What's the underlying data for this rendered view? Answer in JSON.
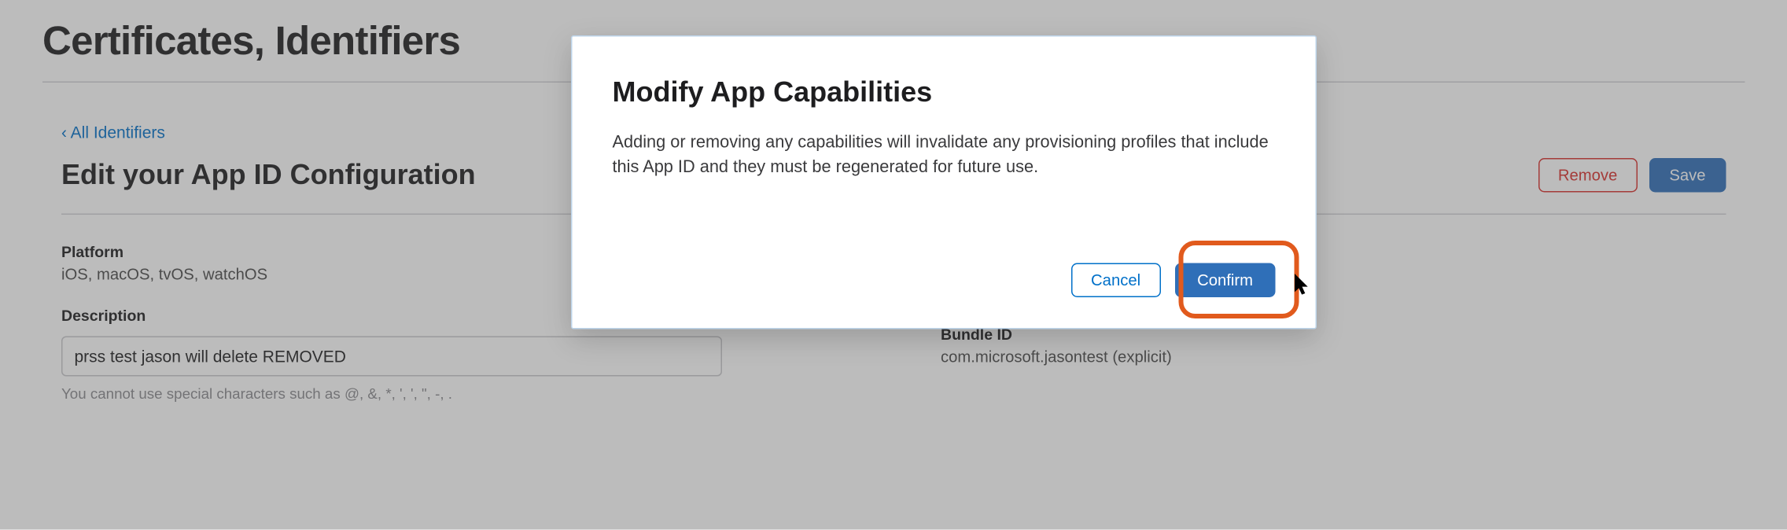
{
  "page": {
    "title": "Certificates, Identifiers",
    "back_link": "‹ All Identifiers",
    "section_title": "Edit your App ID Configuration"
  },
  "actions": {
    "remove": "Remove",
    "save": "Save"
  },
  "fields": {
    "platform_label": "Platform",
    "platform_value": "iOS, macOS, tvOS, watchOS",
    "description_label": "Description",
    "description_value": "prss test jason will delete REMOVED",
    "description_hint": "You cannot use special characters such as @, &, *, ', ', \", -, .",
    "bundle_label": "Bundle ID",
    "bundle_value": "com.microsoft.jasontest (explicit)"
  },
  "modal": {
    "title": "Modify App Capabilities",
    "body": "Adding or removing any capabilities will invalidate any provisioning profiles that include this App ID and they must be regenerated for future use.",
    "cancel": "Cancel",
    "confirm": "Confirm"
  },
  "colors": {
    "link": "#0070c9",
    "primary": "#2f6fb8",
    "danger": "#d9302c",
    "highlight": "#e15a1d"
  }
}
